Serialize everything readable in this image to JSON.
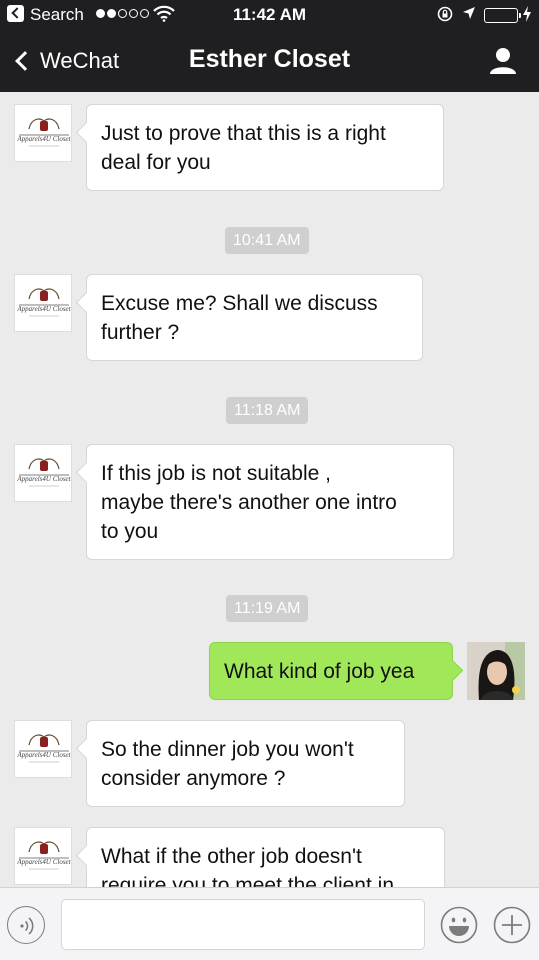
{
  "status_bar": {
    "back_app_label": "Search",
    "time": "11:42 AM"
  },
  "nav": {
    "back_label": "WeChat",
    "title": "Esther Closet"
  },
  "messages": [
    {
      "side": "left",
      "text": "Just to prove that this is a right\ndeal for you"
    },
    {
      "timestamp": "10:41 AM"
    },
    {
      "side": "left",
      "text": "Excuse me? Shall we discuss\nfurther ?"
    },
    {
      "timestamp": "11:18 AM"
    },
    {
      "side": "left",
      "text": "If this job is not suitable ,\nmaybe there's another one intro\nto you"
    },
    {
      "timestamp": "11:19 AM"
    },
    {
      "side": "right",
      "text": "What kind of job yea"
    },
    {
      "side": "left",
      "text": "So the dinner job you won't\nconsider anymore ?"
    },
    {
      "side": "left",
      "text": "What if the other job doesn't\nrequire you to meet the client in"
    }
  ],
  "avatar_logo_text": "Apparels4U Closet",
  "input": {
    "placeholder": ""
  },
  "colors": {
    "nav_bg": "#1f1f21",
    "chat_bg": "#ebebeb",
    "sent_bubble": "#a0e75a",
    "received_bubble": "#ffffff",
    "timestamp_bg": "#cfcfcf",
    "battery": "#4cd964"
  },
  "icons": {
    "voice": "voice-icon",
    "emoji": "emoji-icon",
    "plus": "plus-icon",
    "profile": "profile-icon"
  }
}
